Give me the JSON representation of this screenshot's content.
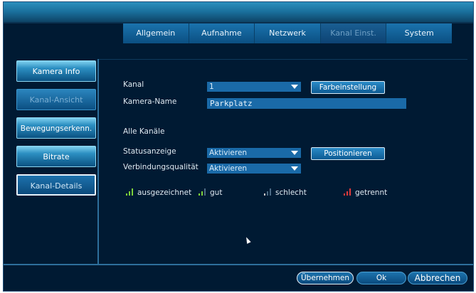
{
  "tabs": [
    {
      "label": "Allgemein"
    },
    {
      "label": "Aufnahme"
    },
    {
      "label": "Netzwerk"
    },
    {
      "label": "Kanal Einst."
    },
    {
      "label": "System"
    }
  ],
  "sidebar": [
    {
      "label": "Kamera Info"
    },
    {
      "label": "Kanal-Ansicht"
    },
    {
      "label": "Bewegungserkenn."
    },
    {
      "label": "Bitrate"
    },
    {
      "label": "Kanal-Details"
    }
  ],
  "form": {
    "kanal_label": "Kanal",
    "kanal_value": "1",
    "farbeinstellung_label": "Farbeinstellung",
    "kamera_name_label": "Kamera-Name",
    "kamera_name_value": "Parkplatz",
    "alle_kanaele_label": "Alle Kanäle",
    "statusanzeige_label": "Statusanzeige",
    "statusanzeige_value": "Aktivieren",
    "positionieren_label": "Positionieren",
    "verbindung_label": "Verbindungsqualität",
    "verbindung_value": "Aktivieren"
  },
  "legend": [
    {
      "label": "ausgezeichnet",
      "color": "#7cd13a"
    },
    {
      "label": "gut",
      "color": "#7cd13a"
    },
    {
      "label": "schlecht",
      "color": "#c9c9c9"
    },
    {
      "label": "getrennt",
      "color": "#e03a3a"
    }
  ],
  "footer": {
    "apply_label": "Übernehmen",
    "ok_label": "Ok",
    "cancel_label": "Abbrechen"
  }
}
